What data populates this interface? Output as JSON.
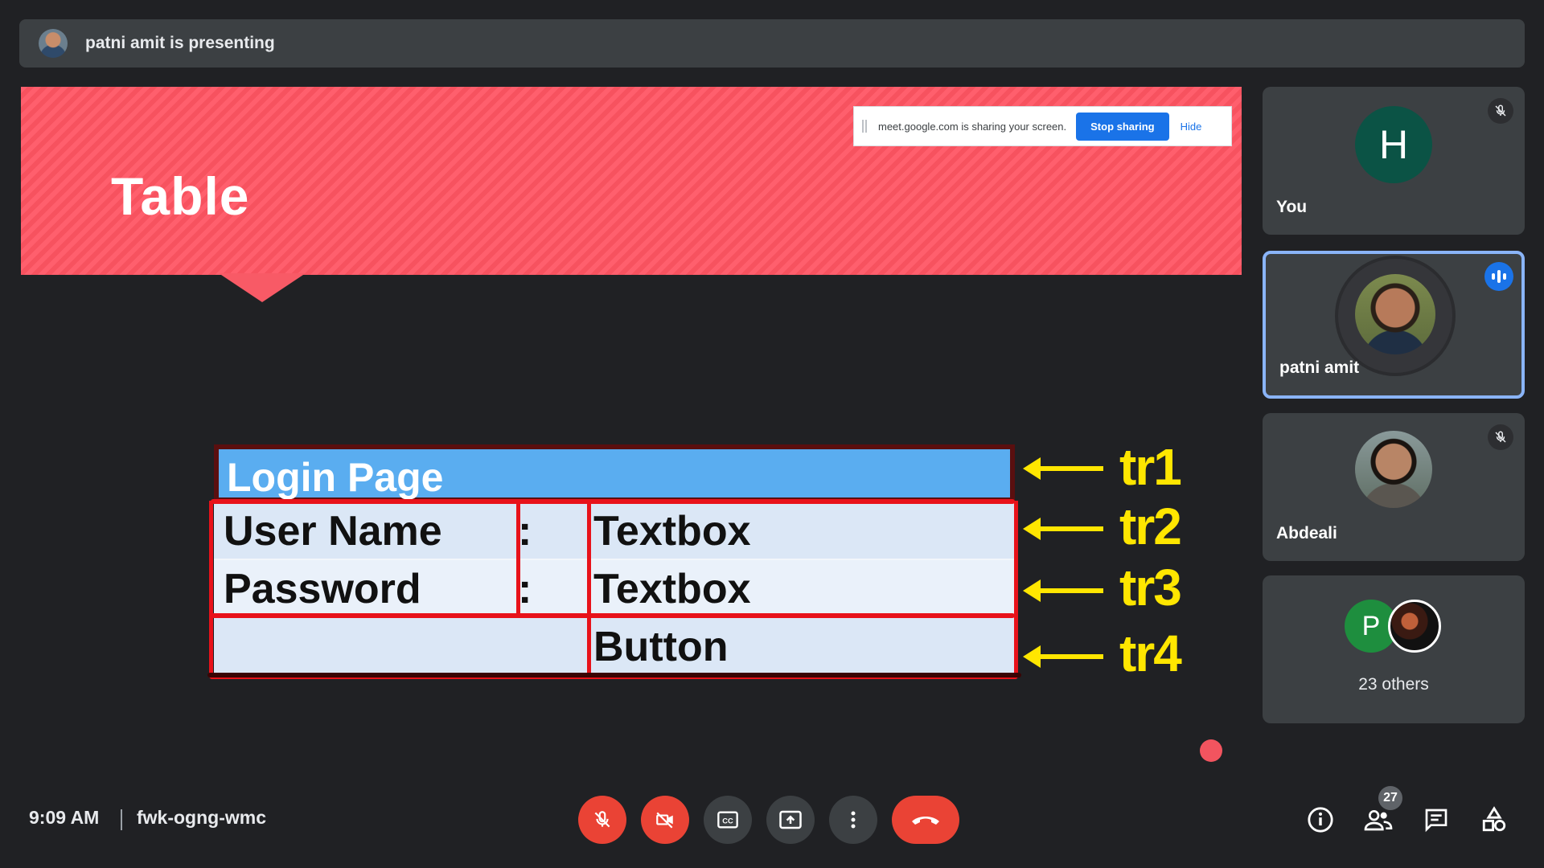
{
  "presenting_bar": {
    "text": "patni amit is presenting"
  },
  "slide": {
    "title": "Table",
    "share_notice": {
      "text": "meet.google.com is sharing your screen.",
      "stop_label": "Stop sharing",
      "hide_label": "Hide"
    },
    "table": {
      "header": "Login Page",
      "rows": [
        {
          "label": "User Name",
          "sep": ":",
          "value": "Textbox"
        },
        {
          "label": "Password",
          "sep": ":",
          "value": "Textbox"
        },
        {
          "label": "",
          "sep": "",
          "value": "Button"
        }
      ]
    },
    "annotations": [
      "tr1",
      "tr2",
      "tr3",
      "tr4"
    ]
  },
  "participants": {
    "you": {
      "name": "You",
      "initial": "H"
    },
    "presenter": {
      "name": "patni amit"
    },
    "third": {
      "name": "Abdeali"
    },
    "others": {
      "initial": "P",
      "text": "23 others"
    }
  },
  "meeting": {
    "time": "9:09 AM",
    "code": "fwk-ogng-wmc",
    "people_count": "27"
  },
  "colors": {
    "accent": "#1a73e8",
    "danger": "#ea4335",
    "annotation": "#ffe600",
    "banner": "#ff5f6d"
  }
}
